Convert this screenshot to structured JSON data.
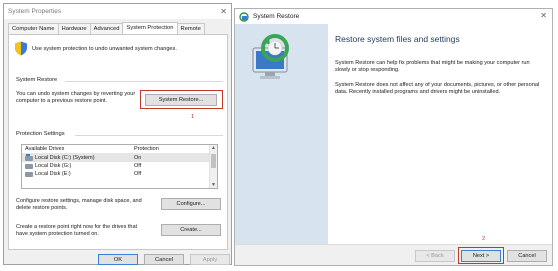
{
  "sys_props": {
    "title": "System Properties",
    "close_glyph": "✕",
    "tabs": [
      "Computer Name",
      "Hardware",
      "Advanced",
      "System Protection",
      "Remote"
    ],
    "intro": "Use system protection to undo unwanted system changes.",
    "restore_group": {
      "title": "System Restore",
      "text": "You can undo system changes by reverting your computer to a previous restore point.",
      "button": "System Restore...",
      "step_number": "1"
    },
    "protection_group": {
      "title": "Protection Settings",
      "col_drives": "Available Drives",
      "col_protection": "Protection",
      "rows": [
        {
          "name": "Local Disk (C:) (System)",
          "protection": "On"
        },
        {
          "name": "Local Disk (G:)",
          "protection": "Off"
        },
        {
          "name": "Local Disk (E:)",
          "protection": "Off"
        }
      ],
      "configure_text": "Configure restore settings, manage disk space, and delete restore points.",
      "configure_button": "Configure...",
      "create_text": "Create a restore point right now for the drives that have system protection turned on.",
      "create_button": "Create..."
    },
    "footer": {
      "ok": "OK",
      "cancel": "Cancel",
      "apply": "Apply"
    }
  },
  "sys_restore": {
    "title": "System Restore",
    "close_glyph": "✕",
    "heading": "Restore system files and settings",
    "para1": "System Restore can help fix problems that might be making your computer run slowly or stop responding.",
    "para2": "System Restore does not affect any of your documents, pictures, or other personal data. Recently installed programs and drivers might be uninstalled.",
    "back": "< Back",
    "next": "Next >",
    "cancel": "Cancel",
    "step_number": "2"
  },
  "colors": {
    "highlight": "#c0392b",
    "panel_blue": "#d7e3ef"
  }
}
